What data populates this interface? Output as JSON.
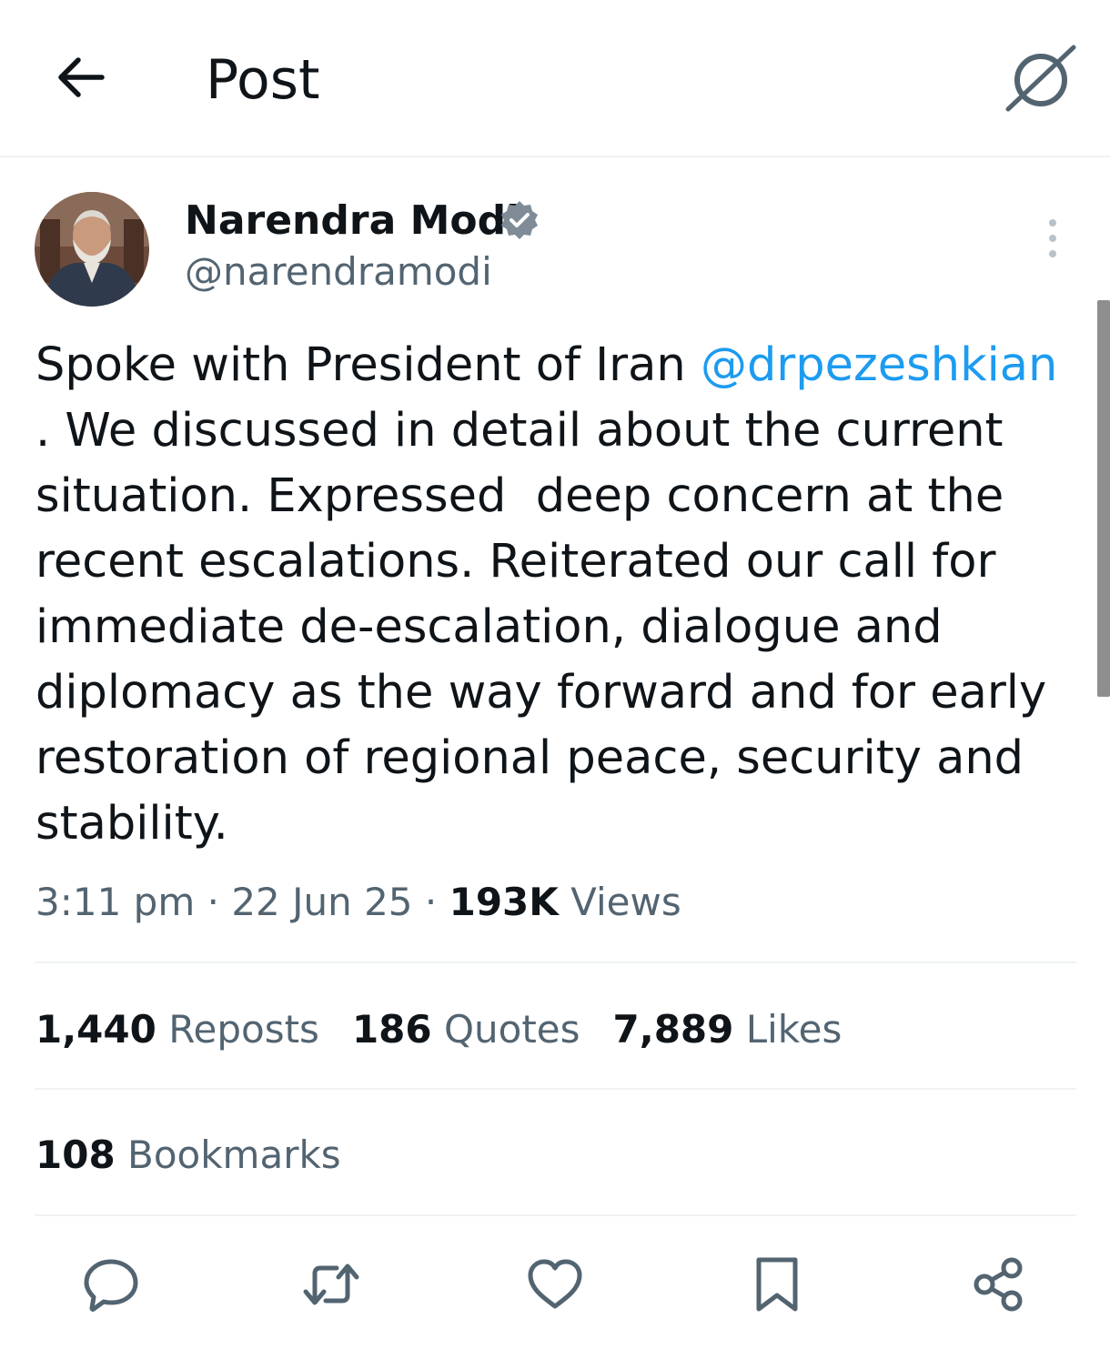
{
  "header": {
    "title": "Post",
    "back_icon": "arrow-left-icon",
    "grok_icon": "grok-icon"
  },
  "author": {
    "name": "Narendra Modi",
    "handle": "@narendramodi",
    "verified": true,
    "verified_color": "#7f8c97"
  },
  "tweet": {
    "text_before": "Spoke with President of Iran ",
    "mention": "@drpezeshkian",
    "text_after": "\n. We discussed in detail about the current situation. Expressed  deep concern at the recent escalations. Reiterated our call for immediate de-escalation, dialogue and diplomacy as the way forward and for early restoration of regional peace, security and stability."
  },
  "meta": {
    "time": "3:11 pm",
    "sep1": " · ",
    "date": "22 Jun 25",
    "sep2": " · ",
    "views_count": "193K",
    "views_label": " Views"
  },
  "stats": {
    "reposts_count": "1,440",
    "reposts_label": " Reposts",
    "quotes_count": "186",
    "quotes_label": " Quotes",
    "likes_count": "7,889",
    "likes_label": " Likes",
    "bookmarks_count": "108",
    "bookmarks_label": " Bookmarks"
  },
  "actions": [
    "reply-icon",
    "repost-icon",
    "like-icon",
    "bookmark-icon",
    "share-icon"
  ],
  "colors": {
    "text": "#0f1419",
    "secondary": "#536471",
    "link": "#1d9bf0",
    "divider": "#eff3f4"
  }
}
